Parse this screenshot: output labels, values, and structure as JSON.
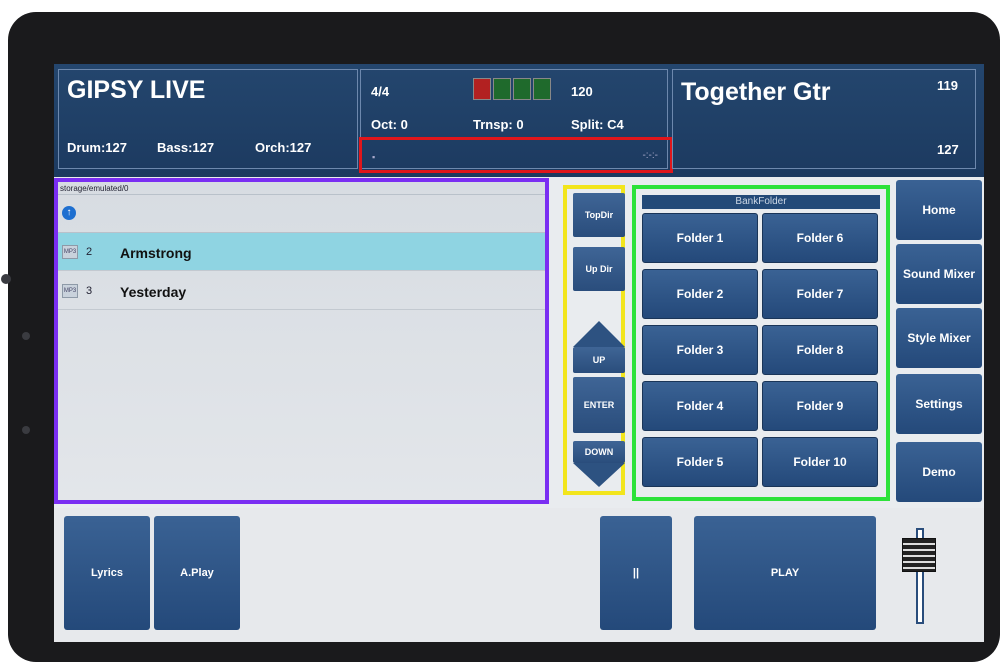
{
  "header": {
    "title": "GIPSY LIVE",
    "drum": "Drum:127",
    "bass": "Bass:127",
    "orch": "Orch:127",
    "time_sig": "4/4",
    "tempo": "120",
    "oct": "Oct: 0",
    "trnsp": "Trnsp: 0",
    "split": "Split: C4",
    "sound_name": "Together Gtr",
    "sound_num": "119",
    "volume": "127",
    "leds": [
      "#b22121",
      "#1f6a2c",
      "#1f6a2c",
      "#1f6a2c"
    ],
    "progress_dot": "▪",
    "progress_end": "-:-:-"
  },
  "browser": {
    "path": "storage/emulated/0",
    "updir_icon": "↑",
    "items": [
      {
        "num": "2",
        "name": "Armstrong",
        "selected": true,
        "icon": "MP3"
      },
      {
        "num": "3",
        "name": "Yesterday",
        "selected": false,
        "icon": "MP3"
      }
    ]
  },
  "nav": {
    "topdir": "TopDir",
    "updir": "Up Dir",
    "up": "UP",
    "enter": "ENTER",
    "down": "DOWN"
  },
  "folders": {
    "header": "BankFolder",
    "items": [
      "Folder 1",
      "Folder 6",
      "Folder 2",
      "Folder 7",
      "Folder 3",
      "Folder 8",
      "Folder 4",
      "Folder 9",
      "Folder 5",
      "Folder 10"
    ]
  },
  "menu": {
    "home": "Home",
    "sound_mixer": "Sound Mixer",
    "style_mixer": "Style Mixer",
    "settings": "Settings",
    "demo": "Demo"
  },
  "bottom": {
    "lyrics": "Lyrics",
    "aplay": "A.Play",
    "pause": "||",
    "play": "PLAY"
  },
  "colors": {
    "header_bg": "#1c3a60",
    "button": "#2a4d7c",
    "selected_row": "#8fd4e2",
    "highlight_red": "#e0161b",
    "highlight_purple": "#7a2ef2",
    "highlight_yellow": "#f2e51c",
    "highlight_green": "#2de23a"
  }
}
